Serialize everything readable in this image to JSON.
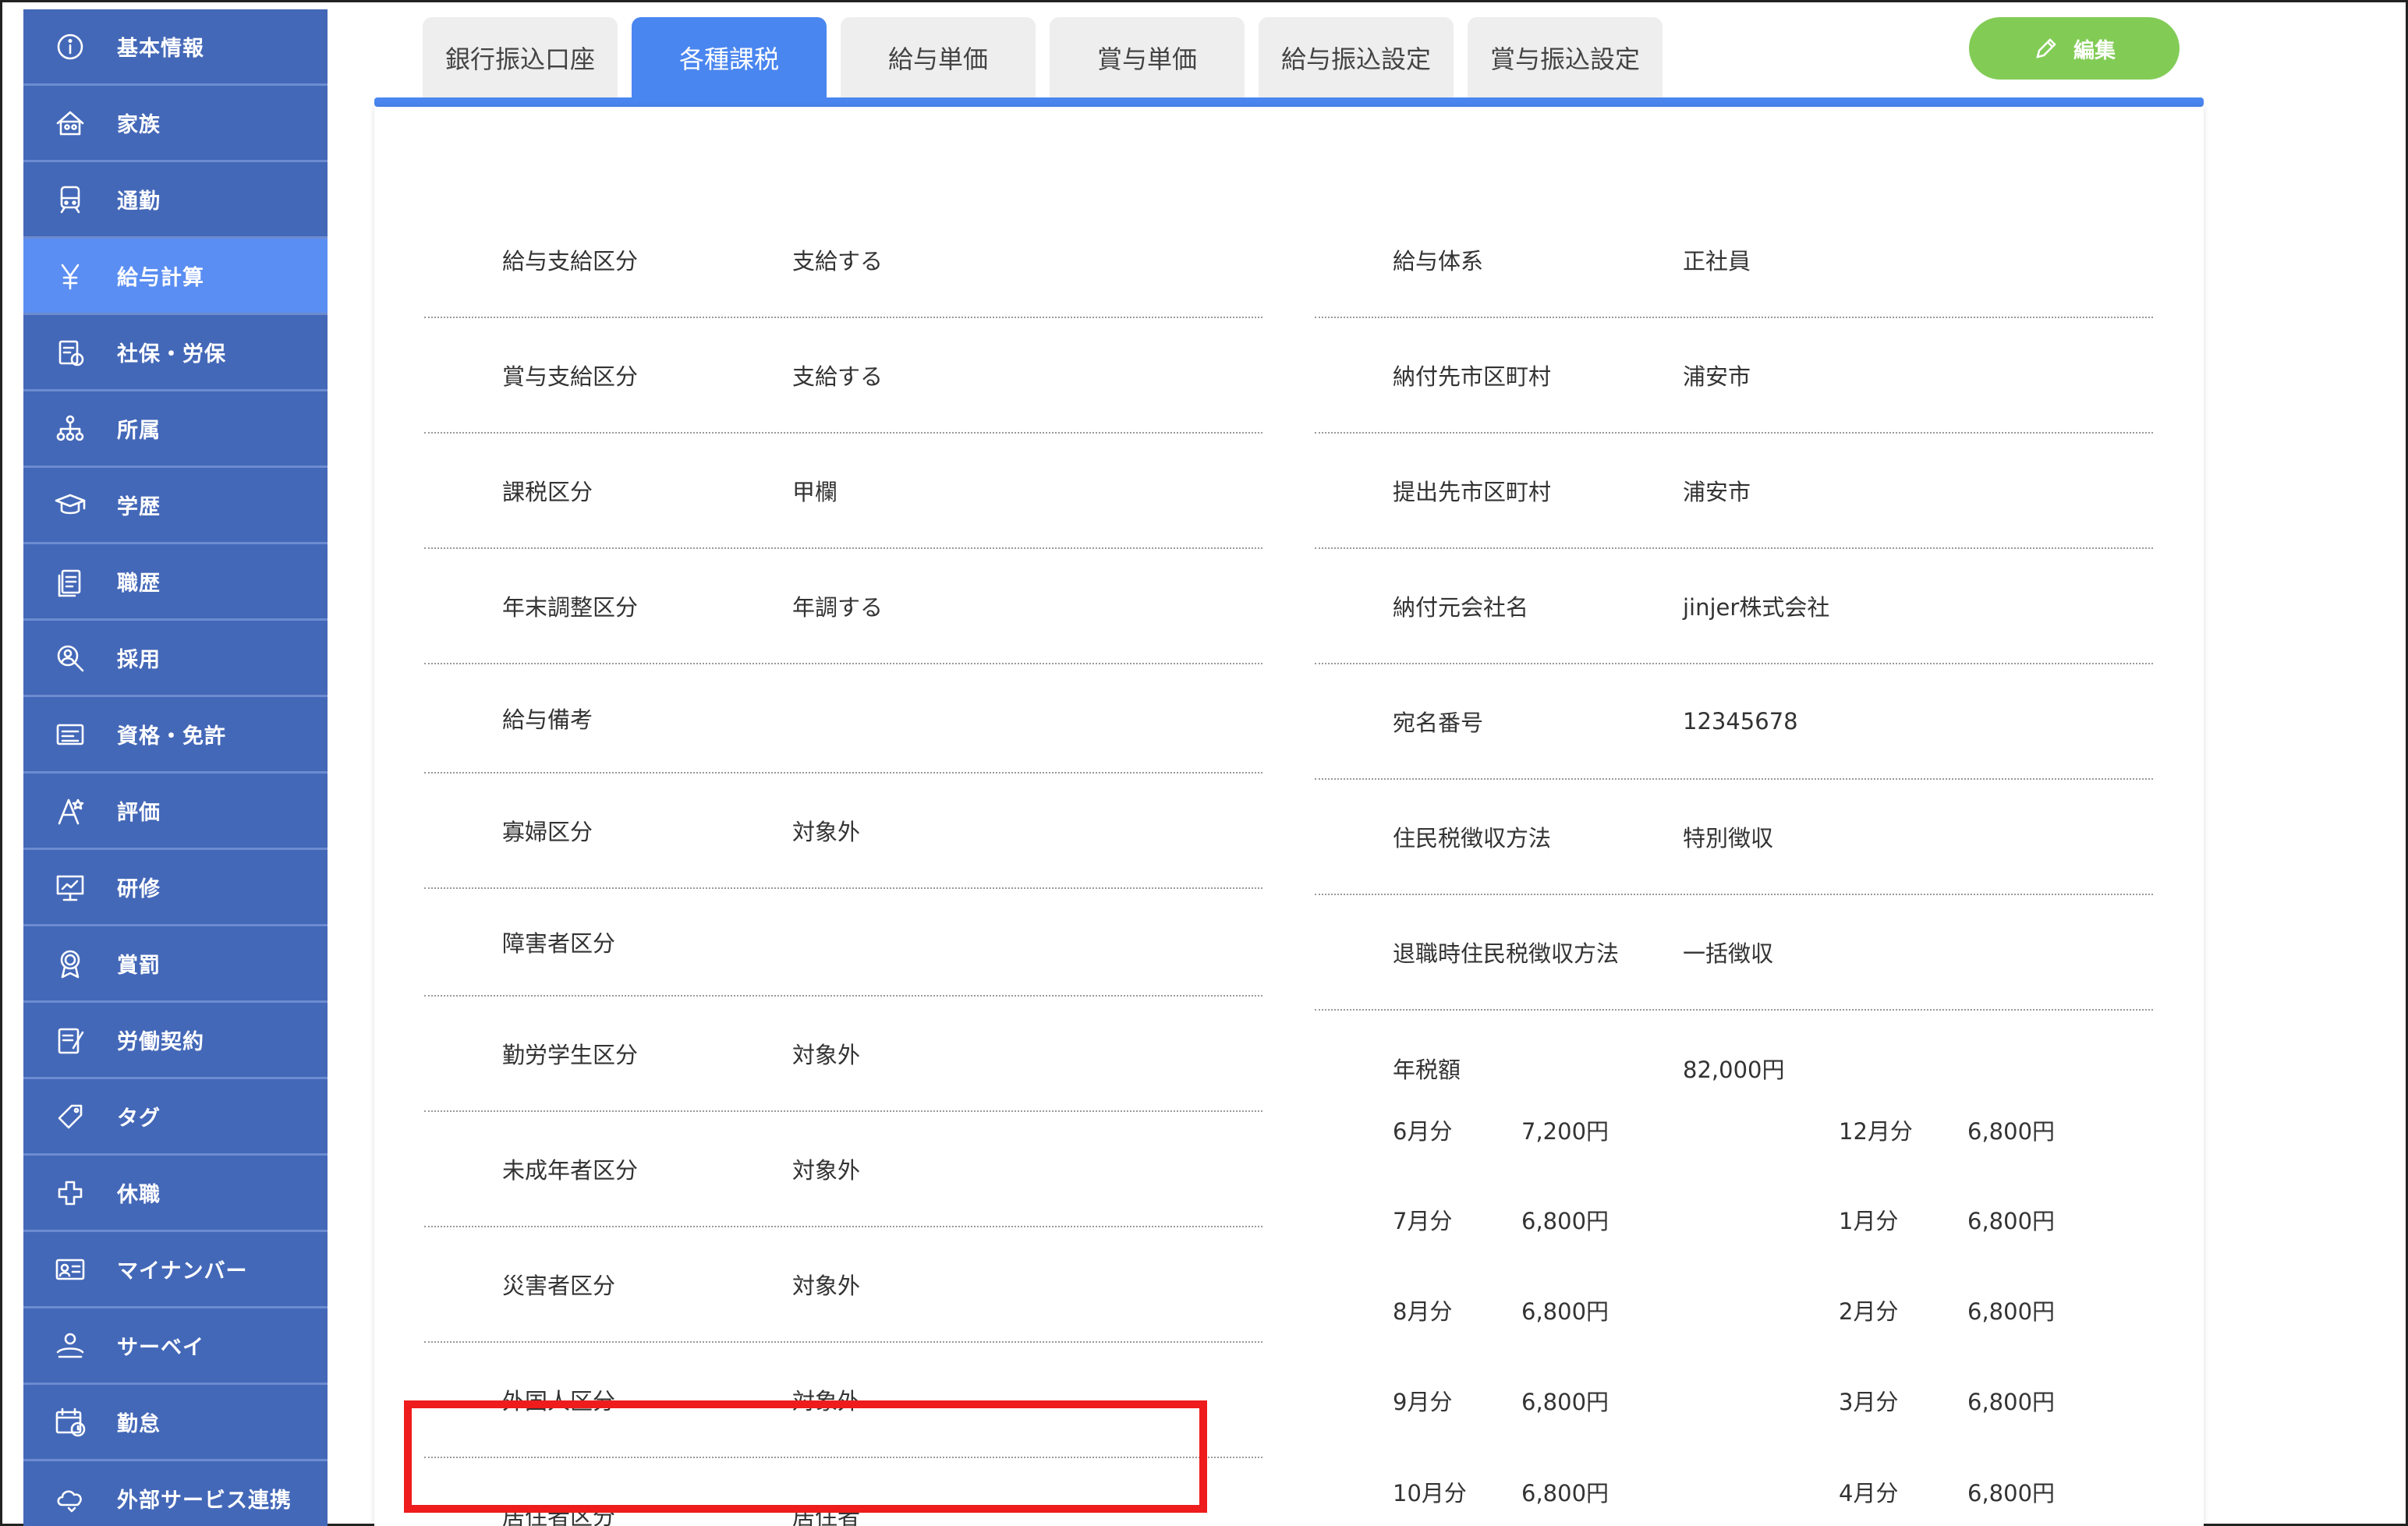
{
  "sidebar": {
    "items": [
      {
        "label": "基本情報",
        "icon": "info-icon"
      },
      {
        "label": "家族",
        "icon": "family-icon"
      },
      {
        "label": "通勤",
        "icon": "train-icon"
      },
      {
        "label": "給与計算",
        "icon": "yen-icon"
      },
      {
        "label": "社保・労保",
        "icon": "insurance-icon"
      },
      {
        "label": "所属",
        "icon": "org-chart-icon"
      },
      {
        "label": "学歴",
        "icon": "graduation-cap-icon"
      },
      {
        "label": "職歴",
        "icon": "career-document-icon"
      },
      {
        "label": "採用",
        "icon": "recruit-search-icon"
      },
      {
        "label": "資格・免許",
        "icon": "license-card-icon"
      },
      {
        "label": "評価",
        "icon": "evaluation-icon"
      },
      {
        "label": "研修",
        "icon": "training-board-icon"
      },
      {
        "label": "賞罰",
        "icon": "award-medal-icon"
      },
      {
        "label": "労働契約",
        "icon": "contract-icon"
      },
      {
        "label": "タグ",
        "icon": "tag-icon"
      },
      {
        "label": "休職",
        "icon": "leave-cross-icon"
      },
      {
        "label": "マイナンバー",
        "icon": "id-card-icon"
      },
      {
        "label": "サーベイ",
        "icon": "survey-icon"
      },
      {
        "label": "勤怠",
        "icon": "calendar-clock-icon"
      },
      {
        "label": "外部サービス連携",
        "icon": "cloud-link-icon"
      }
    ],
    "active_index": 3
  },
  "tabs": [
    {
      "label": "銀行振込口座"
    },
    {
      "label": "各種課税"
    },
    {
      "label": "給与単価"
    },
    {
      "label": "賞与単価"
    },
    {
      "label": "給与振込設定"
    },
    {
      "label": "賞与振込設定"
    }
  ],
  "active_tab": 1,
  "edit_button": {
    "label": "編集",
    "icon": "pencil-icon"
  },
  "left_fields": [
    {
      "label": "給与支給区分",
      "value": "支給する"
    },
    {
      "label": "賞与支給区分",
      "value": "支給する"
    },
    {
      "label": "課税区分",
      "value": "甲欄"
    },
    {
      "label": "年末調整区分",
      "value": "年調する"
    },
    {
      "label": "給与備考",
      "value": ""
    },
    {
      "label": "寡婦区分",
      "value": "対象外"
    },
    {
      "label": "障害者区分",
      "value": ""
    },
    {
      "label": "勤労学生区分",
      "value": "対象外"
    },
    {
      "label": "未成年者区分",
      "value": "対象外"
    },
    {
      "label": "災害者区分",
      "value": "対象外"
    },
    {
      "label": "外国人区分",
      "value": "対象外"
    },
    {
      "label": "居住者区分",
      "value": "居住者"
    }
  ],
  "right_fields": [
    {
      "label": "給与体系",
      "value": "正社員"
    },
    {
      "label": "納付先市区町村",
      "value": "浦安市"
    },
    {
      "label": "提出先市区町村",
      "value": "浦安市"
    },
    {
      "label": "納付元会社名",
      "value": "jinjer株式会社"
    },
    {
      "label": "宛名番号",
      "value": "12345678"
    },
    {
      "label": "住民税徴収方法",
      "value": "特別徴収"
    },
    {
      "label": "退職時住民税徴収方法",
      "value": "一括徴収"
    },
    {
      "label": "年税額",
      "value": "82,000円"
    }
  ],
  "monthly_left": [
    {
      "month": "6月分",
      "amount": "7,200円"
    },
    {
      "month": "7月分",
      "amount": "6,800円"
    },
    {
      "month": "8月分",
      "amount": "6,800円"
    },
    {
      "month": "9月分",
      "amount": "6,800円"
    },
    {
      "month": "10月分",
      "amount": "6,800円"
    }
  ],
  "monthly_right": [
    {
      "month": "12月分",
      "amount": "6,800円"
    },
    {
      "month": "1月分",
      "amount": "6,800円"
    },
    {
      "month": "2月分",
      "amount": "6,800円"
    },
    {
      "month": "3月分",
      "amount": "6,800円"
    },
    {
      "month": "4月分",
      "amount": "6,800円"
    }
  ],
  "colors": {
    "sidebar": "#4468b8",
    "sidebar_active": "#5b8ef2",
    "tab_active": "#4a86f0",
    "edit_button": "#82cc56",
    "highlight": "#ee1c1c"
  }
}
